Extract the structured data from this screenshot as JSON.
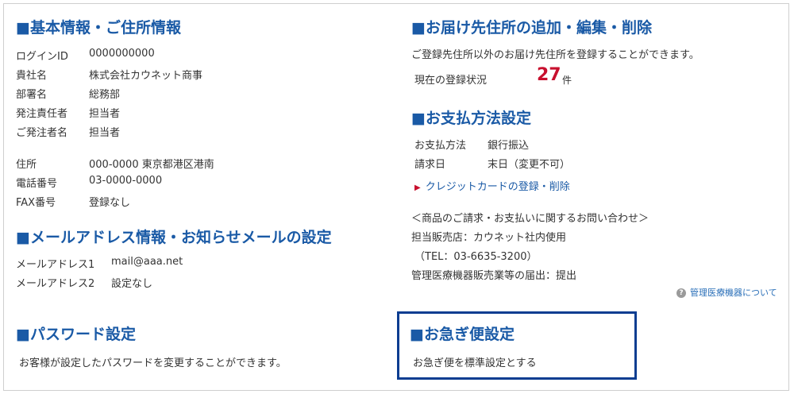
{
  "basic": {
    "title": "■基本情報・ご住所情報",
    "rows": [
      {
        "label": "ログインID",
        "value": "0000000000"
      },
      {
        "label": "貴社名",
        "value": "株式会社カウネット商事"
      },
      {
        "label": "部署名",
        "value": "総務部"
      },
      {
        "label": "発注責任者",
        "value": "担当者"
      },
      {
        "label": "ご発注者名",
        "value": "担当者"
      },
      {
        "label": "住所",
        "value": "000-0000 東京都港区港南"
      },
      {
        "label": "電話番号",
        "value": "03-0000-0000"
      },
      {
        "label": "FAX番号",
        "value": "登録なし"
      }
    ]
  },
  "mail": {
    "title": "■メールアドレス情報・お知らせメールの設定",
    "rows": [
      {
        "label": "メールアドレス1",
        "value": "mail@aaa.net"
      },
      {
        "label": "メールアドレス2",
        "value": "設定なし"
      }
    ]
  },
  "password": {
    "title": "■パスワード設定",
    "desc": "お客様が設定したパスワードを変更することができます。"
  },
  "delivery": {
    "title": "■お届け先住所の追加・編集・削除",
    "desc": "ご登録先住所以外のお届け先住所を登録することができます。",
    "status_label": "現在の登録状況",
    "count": "27",
    "unit": "件"
  },
  "payment": {
    "title": "■お支払方法設定",
    "rows": [
      {
        "label": "お支払方法",
        "value": "銀行振込"
      },
      {
        "label": "請求日",
        "value": "末日（変更不可）"
      }
    ],
    "credit_link": "クレジットカードの登録・削除",
    "inquiry_heading": "＜商品のご請求・お支払いに関するお問い合わせ＞",
    "store": "担当販売店：カウネット社内使用",
    "tel": "（TEL：03-6635-3200）",
    "medical": "管理医療機器販売業等の届出：提出",
    "medical_link": "管理医療機器について"
  },
  "urgent": {
    "title": "■お急ぎ便設定",
    "desc": "お急ぎ便を標準設定とする"
  }
}
